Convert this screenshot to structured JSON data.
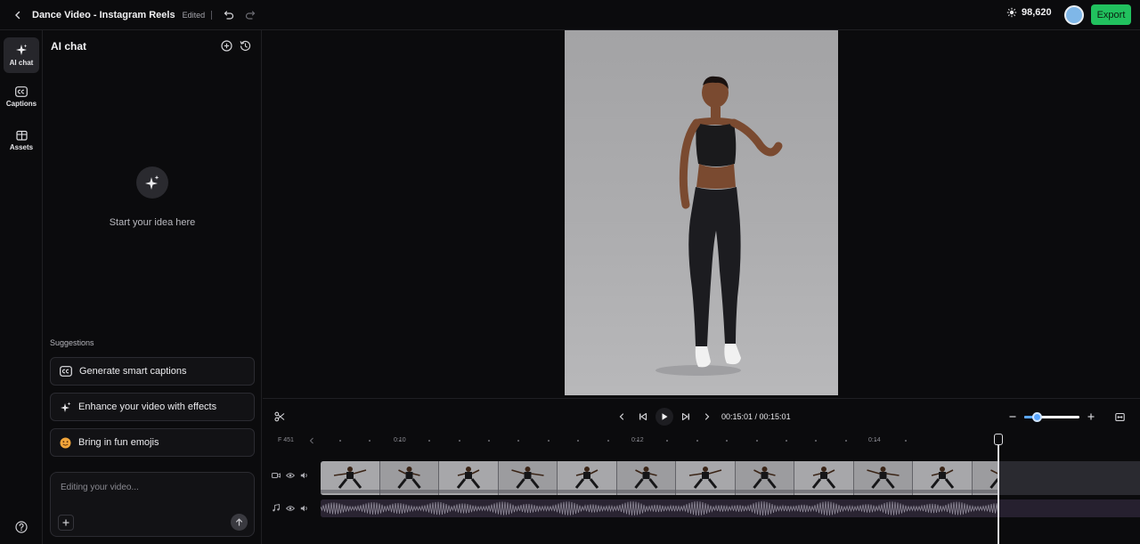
{
  "header": {
    "back_icon": "chevron-left-icon",
    "project_title": "Dance Video - Instagram Reels",
    "status": "Edited",
    "credits": "98,620",
    "export_label": "Export"
  },
  "rail": {
    "items": [
      {
        "label": "AI chat",
        "icon": "sparkles-icon",
        "active": true
      },
      {
        "label": "Captions",
        "icon": "cc-icon",
        "active": false
      },
      {
        "label": "Assets",
        "icon": "box-icon",
        "active": false
      }
    ]
  },
  "chat": {
    "title": "AI chat",
    "empty_text": "Start your idea here",
    "suggestions_label": "Suggestions",
    "suggestions": [
      {
        "label": "Generate smart captions",
        "icon": "cc-icon"
      },
      {
        "label": "Enhance your video with effects",
        "icon": "sparkles-icon"
      },
      {
        "label": "Bring in fun emojis",
        "icon": "emoji-icon"
      }
    ],
    "input_placeholder": "Editing your video..."
  },
  "player": {
    "timecode": "00:15:01 / 00:15:01",
    "zoom_level": 0.23
  },
  "timeline": {
    "ruler_start": "F 451",
    "ruler_marks": [
      "0:10",
      "0:12",
      "0:14"
    ],
    "accent_colors": {
      "export": "#21c15e",
      "zoom": "#5aa7ff"
    }
  }
}
